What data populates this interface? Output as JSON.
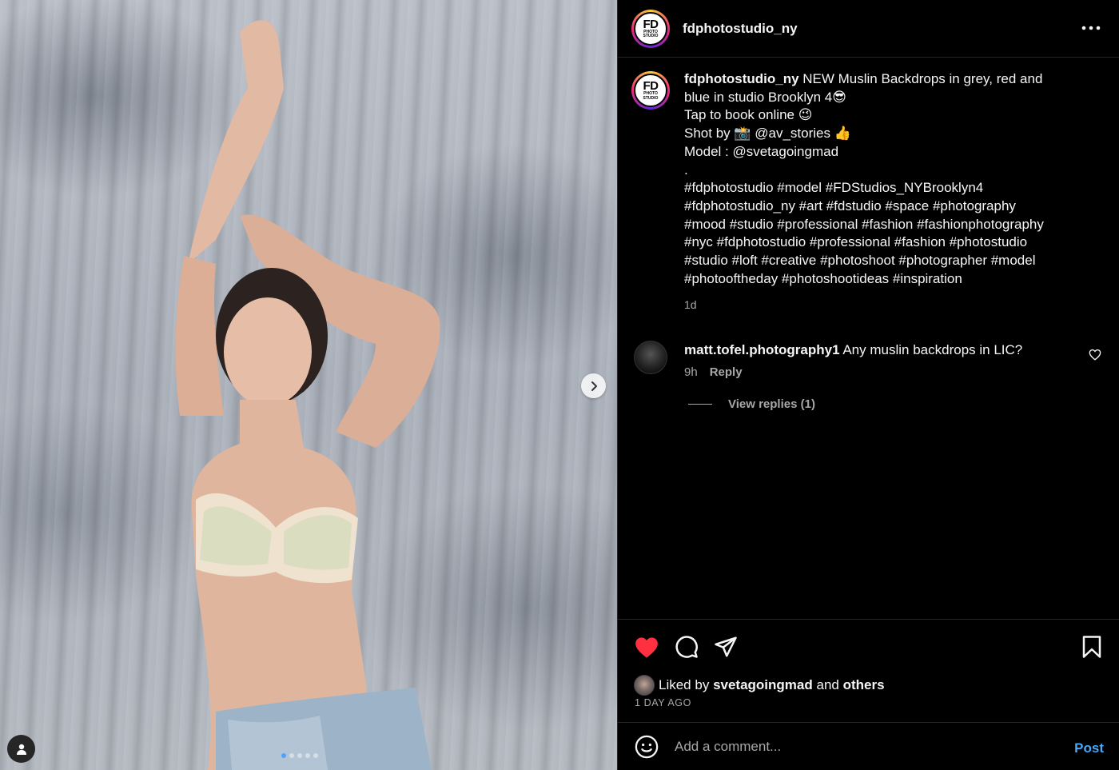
{
  "post": {
    "username": "fdphotostudio_ny",
    "logo": {
      "main": "FD",
      "line1": "PHOTO",
      "line2": "STUDIO"
    },
    "more_icon": "more-horizontal-icon"
  },
  "caption": {
    "username": "fdphotostudio_ny",
    "first_line": " NEW Muslin Backdrops in grey, red and",
    "lines": [
      "blue in studio Brooklyn 4😎",
      "Tap to book online 😉",
      "Shot by 📸  @av_stories 👍",
      "Model : @svetagoingmad",
      ".",
      "#fdphotostudio #model #FDStudios_NYBrooklyn4",
      "#fdphotostudio_ny #art #fdstudio #space #photography",
      "#mood #studio #professional #fashion #fashionphotography",
      "#nyc #fdphotostudio #professional #fashion #photostudio",
      "#studio #loft #creative #photoshoot #photographer #model",
      "#photooftheday #photoshootideas  #inspiration"
    ],
    "time": "1d"
  },
  "comment": {
    "username": "matt.tofel.photography1",
    "text": " Any muslin backdrops in LIC?",
    "time": "9h",
    "reply_label": "Reply",
    "view_replies": "View replies (1)"
  },
  "actions": {
    "like_icon": "heart-filled-icon",
    "comment_icon": "comment-bubble-icon",
    "share_icon": "paper-plane-icon",
    "save_icon": "bookmark-icon",
    "like_color": "#ff3040"
  },
  "likes": {
    "prefix": "Liked by ",
    "user": "svetagoingmad",
    "middle": " and ",
    "others": "others",
    "time_ago": "1 DAY AGO"
  },
  "composer": {
    "placeholder": "Add a comment...",
    "post_label": "Post"
  },
  "carousel": {
    "total_slides": 5,
    "active_index": 0
  }
}
